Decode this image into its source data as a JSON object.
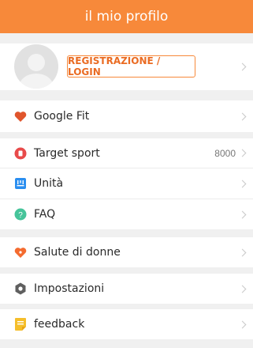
{
  "header": {
    "title": "il mio profilo"
  },
  "profile": {
    "login_label": "REGISTRAZIONE / LOGIN"
  },
  "menu": {
    "google_fit": {
      "label": "Google Fit",
      "icon": "heart-icon",
      "icon_color": "#e0552c"
    },
    "target_sport": {
      "label": "Target sport",
      "value": "8000",
      "icon": "target-icon",
      "icon_color": "#e84a4a"
    },
    "units": {
      "label": "Unità",
      "icon": "ruler-icon",
      "icon_color": "#2a8ef0"
    },
    "faq": {
      "label": "FAQ",
      "icon": "question-icon",
      "icon_color": "#46c49a"
    },
    "women_health": {
      "label": "Salute di donne",
      "icon": "women-heart-icon",
      "icon_color": "#f46b2f"
    },
    "settings": {
      "label": "Impostazioni",
      "icon": "gear-icon",
      "icon_color": "#5f5f5f"
    },
    "feedback": {
      "label": "feedback",
      "icon": "note-icon",
      "icon_color": "#f5be2a"
    }
  },
  "colors": {
    "accent": "#f7893a",
    "background": "#f0f0f0"
  }
}
